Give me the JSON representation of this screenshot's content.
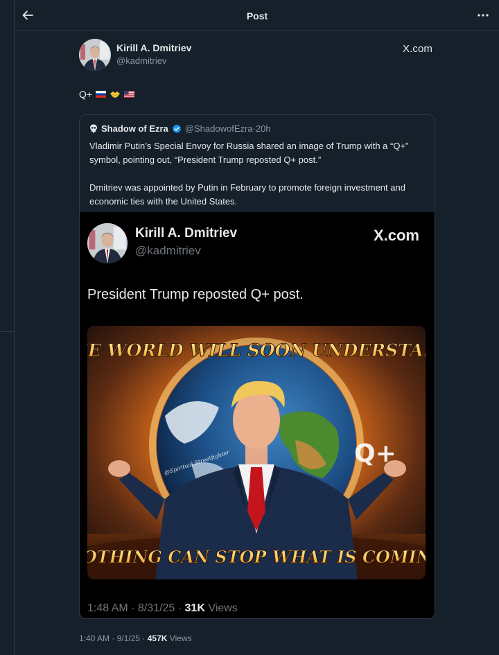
{
  "topbar": {
    "title": "Post",
    "back_icon": "arrow-left-icon",
    "more_icon": "more-dots-icon"
  },
  "post": {
    "author_name": "Kirill A. Dmitriev",
    "author_handle": "@kadmitriev",
    "source_mark": "X.com",
    "text": "Q+",
    "emojis": [
      "russia-flag",
      "handshake",
      "usa-flag"
    ],
    "time": "1:40 AM",
    "date": "9/1/25",
    "views_count": "457K",
    "views_label": "Views"
  },
  "quote": {
    "author_name": "Shadow of Ezra",
    "author_handle": "@ShadowofEzra",
    "time_ago": "20h",
    "paragraphs": [
      "Vladimir Putin’s Special Envoy for Russia shared an image of Trump with a “Q+” symbol, pointing out, “President Trump reposted Q+ post.”",
      "Dmitriev was appointed by Putin in February to promote foreign investment and economic ties with the United States."
    ],
    "embedded": {
      "author_name": "Kirill A. Dmitriev",
      "author_handle": "@kadmitriev",
      "source_mark": "X.com",
      "text": "President Trump reposted Q+ post.",
      "image": {
        "caption_top": "THE WORLD WILL SOON UNDERSTAND",
        "caption_bottom": "NOTHING CAN STOP WHAT IS COMING",
        "overlay_symbol": "Q+",
        "watermark": "@Spiritual Streetfighter"
      },
      "time": "1:48 AM",
      "date": "8/31/25",
      "views_count": "31K",
      "views_label": "Views"
    }
  },
  "colors": {
    "background": "#15202b",
    "border": "#2f3a45",
    "muted": "#8b98a5",
    "verified": "#1d9bf0"
  }
}
